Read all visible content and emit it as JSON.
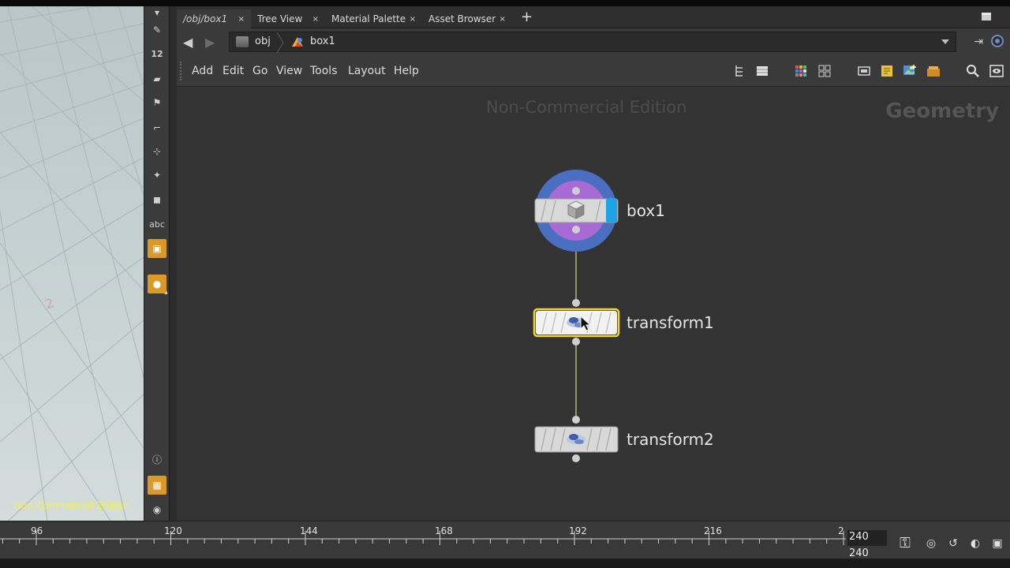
{
  "tabs": [
    {
      "label": "/obj/box1",
      "active": true
    },
    {
      "label": "Tree View"
    },
    {
      "label": "Material Palette"
    },
    {
      "label": "Asset Browser"
    }
  ],
  "tab_close": "×",
  "tab_add": "+",
  "path": {
    "crumbs": [
      "obj",
      "box1"
    ]
  },
  "menu": [
    "Add",
    "Edit",
    "Go",
    "View",
    "Tools",
    "Layout",
    "Help"
  ],
  "network": {
    "watermark": "Non-Commercial Edition",
    "context": "Geometry",
    "nodes": [
      {
        "name": "box1",
        "display_flag": true
      },
      {
        "name": "transform1",
        "selected": true
      },
      {
        "name": "transform2"
      }
    ]
  },
  "viewport": {
    "watermark": "Non-Commercial Edition",
    "grid_label": "2"
  },
  "viewport_tools": {
    "snap_label": "12",
    "text_tool": "abc"
  },
  "timeline": {
    "ticks": [
      "96",
      "120",
      "144",
      "168",
      "192",
      "216",
      "2"
    ],
    "end_frame": "240",
    "range_end": "240"
  },
  "colors": {
    "accent": "#d99a2a",
    "selection": "#f2d42a",
    "display_flag": "#1ea3e6",
    "node_ring": "#4a6fc0"
  }
}
